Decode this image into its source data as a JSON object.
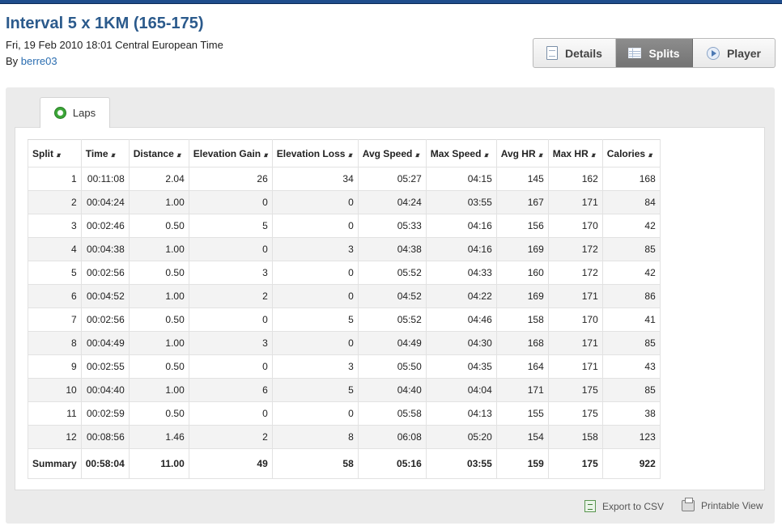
{
  "header": {
    "title": "Interval 5 x 1KM (165-175)",
    "subtitle": "Fri, 19 Feb 2010 18:01 Central European Time",
    "by_label": "By",
    "author": "berre03"
  },
  "view_tabs": {
    "details": "Details",
    "splits": "Splits",
    "player": "Player",
    "active": "Splits"
  },
  "content_tabs": {
    "laps": "Laps"
  },
  "sort_icon": "sort-arrows-icon",
  "table": {
    "columns": [
      "Split",
      "Time",
      "Distance",
      "Elevation Gain",
      "Elevation Loss",
      "Avg Speed",
      "Max Speed",
      "Avg HR",
      "Max HR",
      "Calories"
    ],
    "rows": [
      [
        "1",
        "00:11:08",
        "2.04",
        "26",
        "34",
        "05:27",
        "04:15",
        "145",
        "162",
        "168"
      ],
      [
        "2",
        "00:04:24",
        "1.00",
        "0",
        "0",
        "04:24",
        "03:55",
        "167",
        "171",
        "84"
      ],
      [
        "3",
        "00:02:46",
        "0.50",
        "5",
        "0",
        "05:33",
        "04:16",
        "156",
        "170",
        "42"
      ],
      [
        "4",
        "00:04:38",
        "1.00",
        "0",
        "3",
        "04:38",
        "04:16",
        "169",
        "172",
        "85"
      ],
      [
        "5",
        "00:02:56",
        "0.50",
        "3",
        "0",
        "05:52",
        "04:33",
        "160",
        "172",
        "42"
      ],
      [
        "6",
        "00:04:52",
        "1.00",
        "2",
        "0",
        "04:52",
        "04:22",
        "169",
        "171",
        "86"
      ],
      [
        "7",
        "00:02:56",
        "0.50",
        "0",
        "5",
        "05:52",
        "04:46",
        "158",
        "170",
        "41"
      ],
      [
        "8",
        "00:04:49",
        "1.00",
        "3",
        "0",
        "04:49",
        "04:30",
        "168",
        "171",
        "85"
      ],
      [
        "9",
        "00:02:55",
        "0.50",
        "0",
        "3",
        "05:50",
        "04:35",
        "164",
        "171",
        "43"
      ],
      [
        "10",
        "00:04:40",
        "1.00",
        "6",
        "5",
        "04:40",
        "04:04",
        "171",
        "175",
        "85"
      ],
      [
        "11",
        "00:02:59",
        "0.50",
        "0",
        "0",
        "05:58",
        "04:13",
        "155",
        "175",
        "38"
      ],
      [
        "12",
        "00:08:56",
        "1.46",
        "2",
        "8",
        "06:08",
        "05:20",
        "154",
        "158",
        "123"
      ]
    ],
    "summary": [
      "Summary",
      "00:58:04",
      "11.00",
      "49",
      "58",
      "05:16",
      "03:55",
      "159",
      "175",
      "922"
    ]
  },
  "footer": {
    "export_csv": "Export to CSV",
    "printable_view": "Printable View"
  },
  "colors": {
    "top_bar": "#1f4d8c",
    "title": "#2b5a8c",
    "link": "#2a6db0",
    "active_tab": "#7f7f7f",
    "panel": "#ebebeb"
  }
}
